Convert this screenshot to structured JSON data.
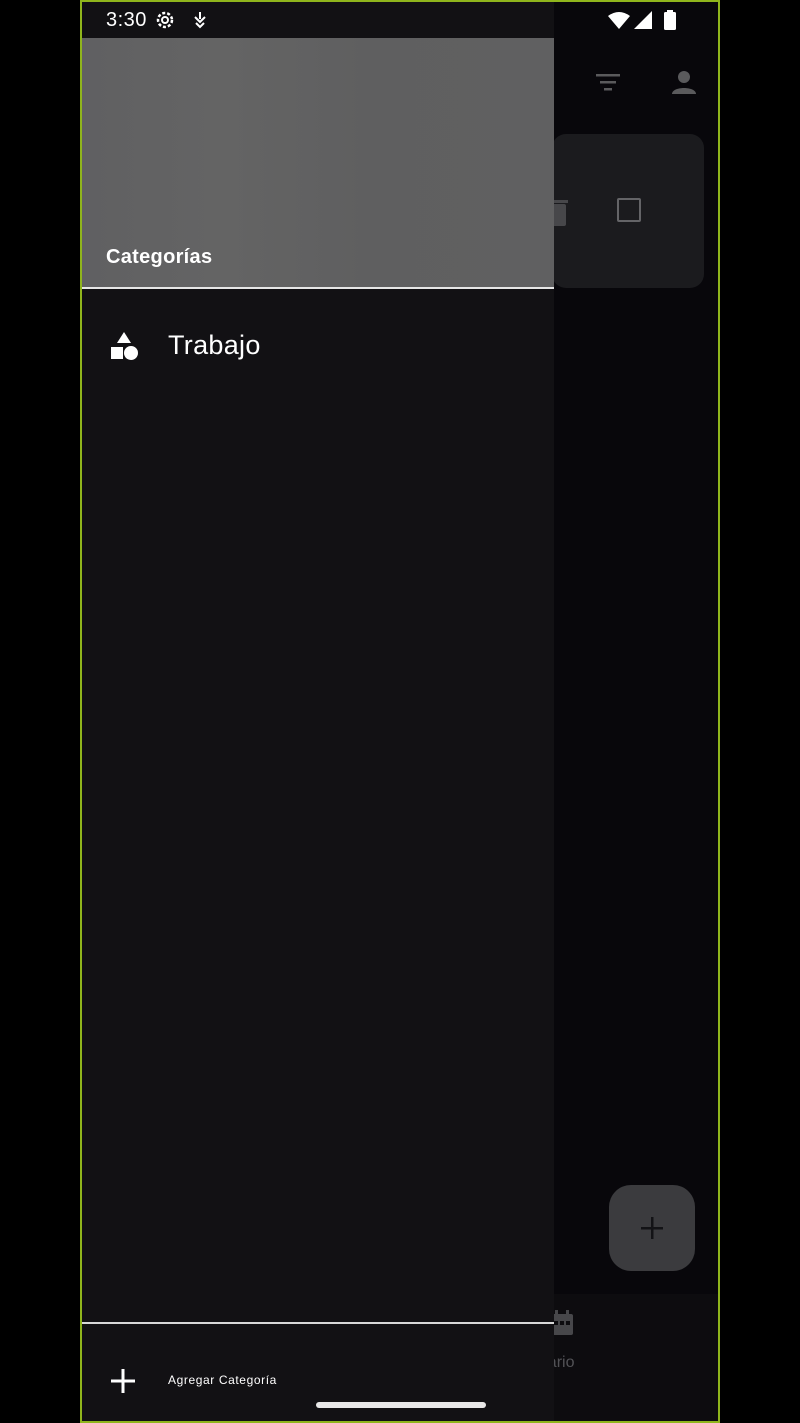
{
  "status_bar": {
    "time": "3:30",
    "icons": [
      "gear-icon",
      "drop-icon",
      "wifi-icon",
      "signal-icon",
      "battery-icon"
    ]
  },
  "app": {
    "top_icons": [
      "filter-icon",
      "profile-icon"
    ],
    "card_icons": [
      "trash-icon",
      "checkbox-icon"
    ],
    "fab_icon": "plus-icon",
    "bottom_nav": {
      "calendar_label": "ndario",
      "calendar_icon": "calendar-icon"
    }
  },
  "drawer": {
    "title": "Categorías",
    "items": [
      {
        "label": "Trabajo",
        "icon": "category-shapes-icon"
      }
    ],
    "add_label": "Agregar Categoría",
    "add_icon": "plus-icon"
  },
  "colors": {
    "frame": "#8fb51c",
    "drawer_bg": "#121114",
    "header_bg": "#606060",
    "text": "#ffffff"
  }
}
